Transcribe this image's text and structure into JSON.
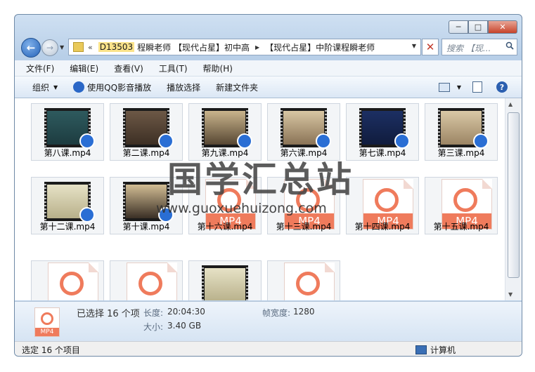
{
  "window": {
    "caption": {
      "minimize": "─",
      "maximize": "□",
      "close": "✕"
    }
  },
  "nav": {
    "back_icon": "arrow-left-icon",
    "forward_icon": "arrow-right-icon",
    "breadcrumb": {
      "overflow": "«",
      "segments": [
        "D13503",
        "程瞬老师 【现代占星】初中高",
        "【现代占星】中阶课程瞬老师"
      ]
    },
    "search_placeholder": "搜索 【现...",
    "accent_color": "#2563b8"
  },
  "menu": [
    "文件(F)",
    "编辑(E)",
    "查看(V)",
    "工具(T)",
    "帮助(H)"
  ],
  "toolbar": {
    "organize": "组织",
    "play_qq": "使用QQ影音播放",
    "play_selected": "播放选择",
    "new_folder": "新建文件夹"
  },
  "files": [
    {
      "name": "第八课.mp4",
      "kind": "video"
    },
    {
      "name": "第二课.mp4",
      "kind": "video"
    },
    {
      "name": "第九课.mp4",
      "kind": "video"
    },
    {
      "name": "第六课.mp4",
      "kind": "video"
    },
    {
      "name": "第七课.mp4",
      "kind": "video"
    },
    {
      "name": "第三课.mp4",
      "kind": "video"
    },
    {
      "name": "第十二课.mp4",
      "kind": "video"
    },
    {
      "name": "第十课.mp4",
      "kind": "video"
    },
    {
      "name": "第十六课.mp4",
      "kind": "doc"
    },
    {
      "name": "第十三课.mp4",
      "kind": "doc"
    },
    {
      "name": "第十四课.mp4",
      "kind": "doc"
    },
    {
      "name": "第十五课.mp4",
      "kind": "doc"
    },
    {
      "name": "",
      "kind": "doc"
    },
    {
      "name": "",
      "kind": "doc"
    },
    {
      "name": "",
      "kind": "video"
    },
    {
      "name": "",
      "kind": "doc"
    }
  ],
  "mp4_label": "MP4",
  "details": {
    "selected": "已选择 16 个项",
    "length_key": "长度:",
    "length_val": "20:04:30",
    "size_key": "大小:",
    "size_val": "3.40 GB",
    "framewidth_key": "帧宽度:",
    "framewidth_val": "1280"
  },
  "status": {
    "left": "选定 16 个项目",
    "right": "计算机"
  },
  "watermark": {
    "cn": "国学汇总站",
    "url": "www.guoxuehuizong.com"
  }
}
